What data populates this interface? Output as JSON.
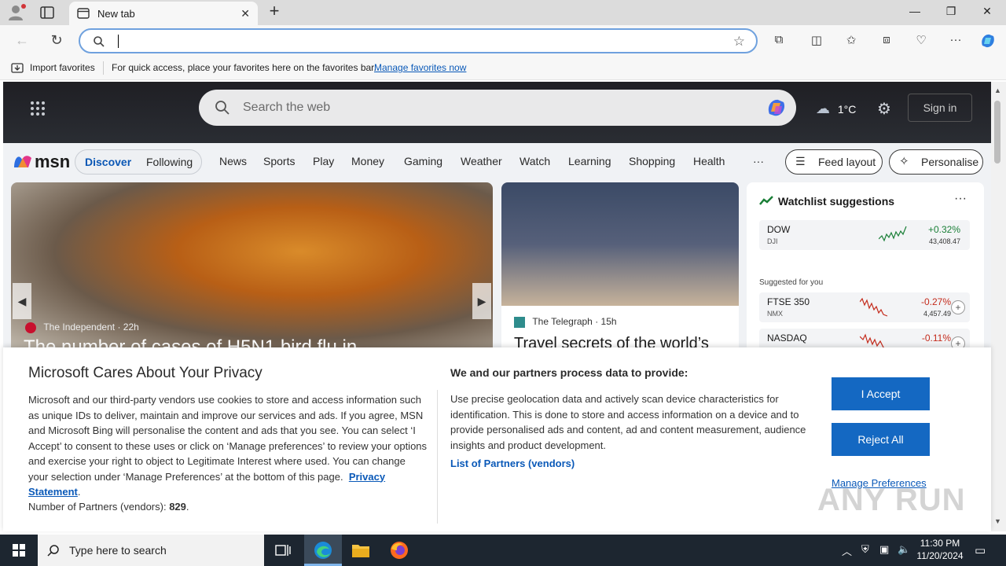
{
  "browser": {
    "tab_title": "New tab",
    "address_value": "",
    "favorites_bar": {
      "import_label": "Import favorites",
      "hint": "For quick access, place your favorites here on the favorites bar.",
      "manage_link": "Manage favorites now"
    }
  },
  "msn": {
    "search_placeholder": "Search the web",
    "weather_temp": "1°C",
    "signin_label": "Sign in",
    "logo_text": "msn",
    "discover": "Discover",
    "following": "Following",
    "nav": [
      "News",
      "Sports",
      "Play",
      "Money",
      "Gaming",
      "Weather",
      "Watch",
      "Learning",
      "Shopping",
      "Health"
    ],
    "more_label": "···",
    "feed_layout": "Feed layout",
    "personalise": "Personalise",
    "hero": {
      "source": "The Independent",
      "age": "22h",
      "headline": "The number of cases of H5N1 bird flu in"
    },
    "story2": {
      "source": "The Telegraph",
      "age": "15h",
      "headline": "Travel secrets of the world’s"
    },
    "watchlist": {
      "title": "Watchlist suggestions",
      "suggested_label": "Suggested for you",
      "quotes": [
        {
          "symbol": "DOW",
          "exchange": "DJI",
          "change": "+0.32%",
          "price": "43,408.47",
          "dir": "up"
        },
        {
          "symbol": "FTSE 350",
          "exchange": "NMX",
          "change": "-0.27%",
          "price": "4,457.49",
          "dir": "down"
        },
        {
          "symbol": "NASDAQ",
          "exchange": "",
          "change": "-0.11%",
          "price": "",
          "dir": "down"
        }
      ]
    }
  },
  "privacy": {
    "title": "Microsoft Cares About Your Privacy",
    "body": "Microsoft and our third-party vendors use cookies to store and access information such as unique IDs to deliver, maintain and improve our services and ads. If you agree, MSN and Microsoft Bing will personalise the content and ads that you see. You can select ‘I Accept’ to consent to these uses or click on ‘Manage preferences’ to review your options and exercise your right to object to Legitimate Interest where used.  You can change your selection under ‘Manage Preferences’ at the bottom of this page.",
    "privacy_link": "Privacy Statement",
    "partners_label": "Number of Partners (vendors):",
    "partners_count": "829",
    "right_title": "We and our partners process data to provide:",
    "right_body": "Use precise geolocation data and actively scan device characteristics for identification. This is done to store and access information on a device and to provide personalised ads and content, ad and content measurement, audience insights and product development.",
    "list_link": "List of Partners (vendors)",
    "accept": "I Accept",
    "reject": "Reject All",
    "manage": "Manage Preferences"
  },
  "watermark": "ANY RUN",
  "taskbar": {
    "search_placeholder": "Type here to search",
    "time": "11:30 PM",
    "date": "11/20/2024"
  },
  "colors": {
    "accent": "#1468c2",
    "link": "#0a59b8",
    "up": "#1a7f37",
    "down": "#c42b1c"
  }
}
